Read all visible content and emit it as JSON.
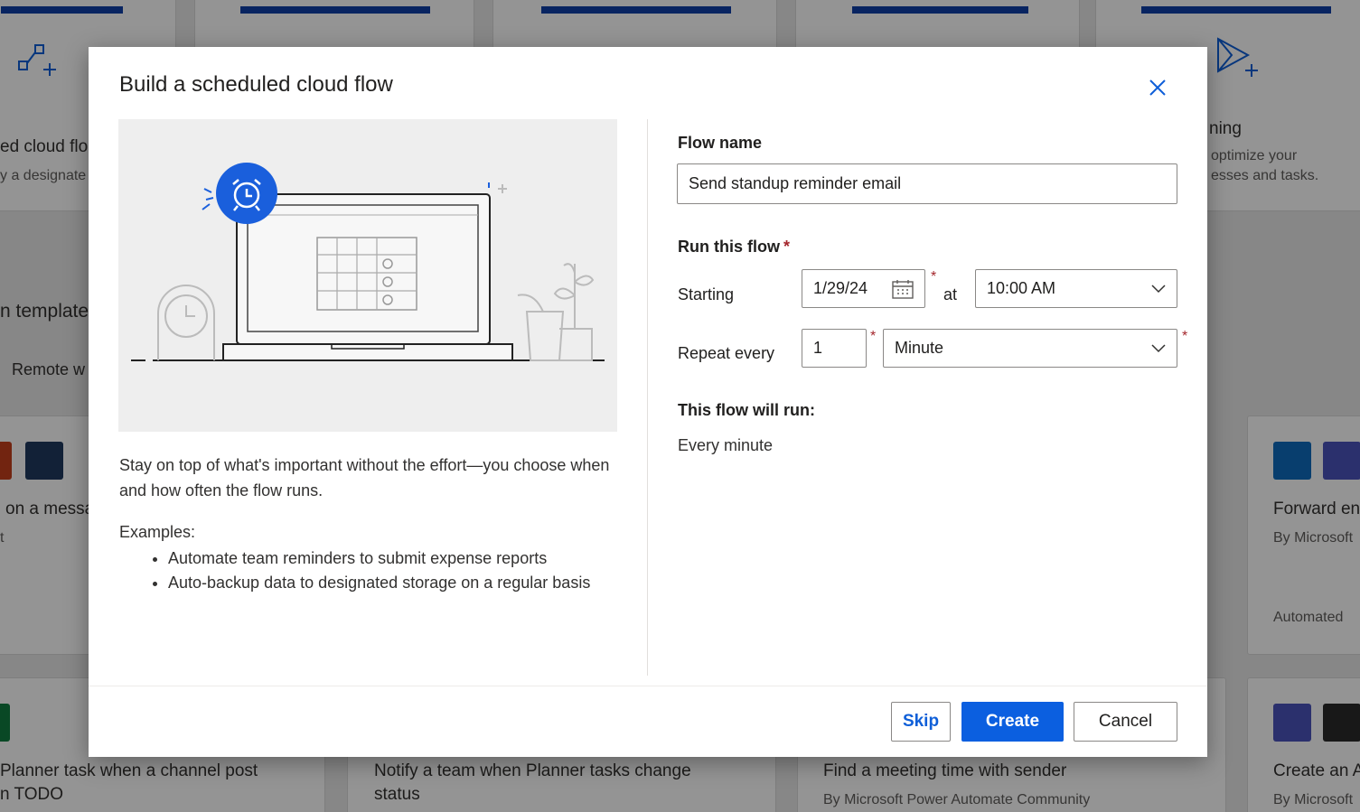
{
  "background": {
    "cards_top": [
      {
        "title_fragment": "ed cloud flo",
        "sub_fragment": "y a designate"
      },
      {
        "title_fragment": "ning",
        "sub_fragment": "optimize your",
        "sub_fragment2": "esses and tasks."
      }
    ],
    "section_title_fragment": "n template",
    "filter_fragment": "Remote w",
    "cards_mid": [
      {
        "title_fragment": "on a messa",
        "sub_fragment": "t"
      },
      {
        "title": "Forward en",
        "by": "By Microsoft",
        "type": "Automated"
      }
    ],
    "cards_bottom": [
      {
        "line1": "Planner task when a channel post",
        "line2": "n TODO"
      },
      {
        "line1": "Notify a team when Planner tasks change",
        "line2": "status"
      },
      {
        "line1": "Find a meeting time with sender",
        "by": "By Microsoft Power Automate Community"
      },
      {
        "line1": "Create an A",
        "by": "By Microsoft"
      }
    ]
  },
  "dialog": {
    "title": "Build a scheduled cloud flow",
    "description": "Stay on top of what's important without the effort—you choose when and how often the flow runs.",
    "examples_label": "Examples:",
    "examples": [
      "Automate team reminders to submit expense reports",
      "Auto-backup data to designated storage on a regular basis"
    ],
    "form": {
      "flow_name_label": "Flow name",
      "flow_name_value": "Send standup reminder email",
      "run_label": "Run this flow",
      "required_mark": "*",
      "starting_label": "Starting",
      "start_date": "1/29/24",
      "at_label": "at",
      "start_time": "10:00 AM",
      "repeat_label": "Repeat every",
      "repeat_interval": "1",
      "repeat_unit": "Minute",
      "summary_label": "This flow will run:",
      "summary_value": "Every minute"
    },
    "buttons": {
      "skip": "Skip",
      "create": "Create",
      "cancel": "Cancel"
    }
  },
  "colors": {
    "primary": "#0b5fe0",
    "accent_bar": "#0f3ea8",
    "required": "#a4262c"
  }
}
